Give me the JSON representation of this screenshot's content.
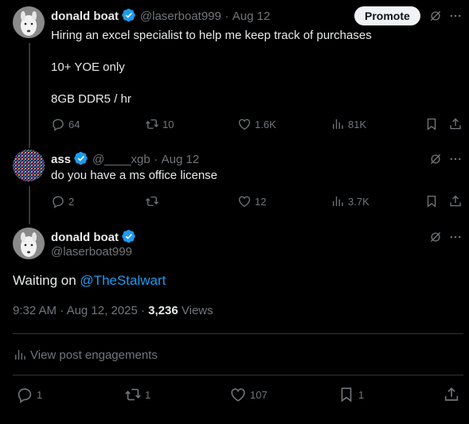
{
  "tweet1": {
    "name": "donald boat",
    "handle": "@laserboat999",
    "dot": "·",
    "date": "Aug 12",
    "promote_label": "Promote",
    "line1": "Hiring an excel specialist to help me keep track of purchases",
    "line2": "10+ YOE only",
    "line3": "8GB DDR5 / hr",
    "replies": "64",
    "reposts": "10",
    "likes": "1.6K",
    "views": "81K"
  },
  "tweet2": {
    "name": "ass",
    "handle": "@____xgb",
    "dot": "·",
    "date": "Aug 12",
    "text": "do you have a ms office license",
    "replies": "2",
    "reposts": "",
    "likes": "12",
    "views": "3.7K"
  },
  "main": {
    "name": "donald boat",
    "handle": "@laserboat999",
    "text_prefix": "Waiting on ",
    "mention": "@TheStalwart",
    "time": "9:32 AM",
    "dot1": "·",
    "date": "Aug 12, 2025",
    "dot2": "·",
    "views_count": "3,236",
    "views_label": "Views",
    "engagements_label": "View post engagements",
    "replies": "1",
    "reposts": "1",
    "likes": "107",
    "bookmarks": "1"
  },
  "icons": {
    "more": "more-icon",
    "grok": "grok-icon",
    "verified": "verified-icon",
    "reply": "reply-icon",
    "repost": "repost-icon",
    "like": "like-icon",
    "views": "views-icon",
    "bookmark": "bookmark-icon",
    "share": "share-icon"
  },
  "colors": {
    "background": "#000000",
    "text": "#e7e9ea",
    "muted": "#71767b",
    "accent": "#1d9bf0",
    "divider": "#2f3336"
  }
}
